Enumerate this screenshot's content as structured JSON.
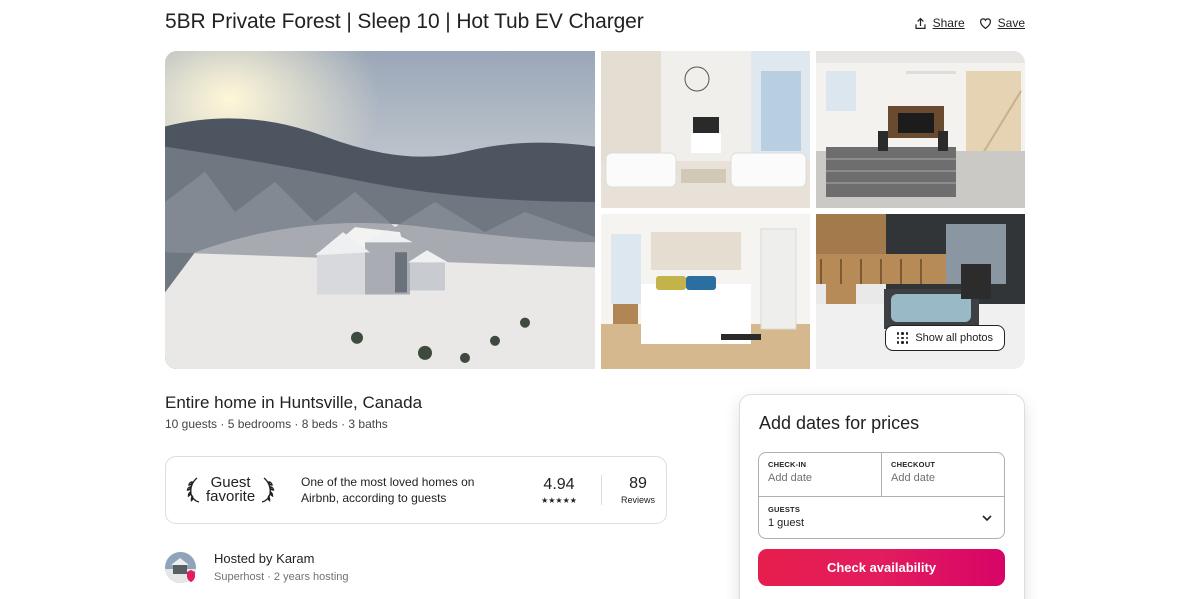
{
  "listing": {
    "title": "5BR Private Forest | Sleep 10 | Hot Tub EV Charger",
    "subtitle": "Entire home in Huntsville, Canada",
    "meta": "10 guests · 5 bedrooms · 8 beds · 3 baths"
  },
  "actions": {
    "share_label": "Share",
    "save_label": "Save",
    "share_icon": "share-icon",
    "save_icon": "heart-icon"
  },
  "gallery": {
    "photos": [
      {
        "name": "snowy-house-aerial-photo"
      },
      {
        "name": "living-room-photo"
      },
      {
        "name": "game-room-photo"
      },
      {
        "name": "bedroom-photo"
      },
      {
        "name": "hot-tub-deck-photo"
      }
    ],
    "show_all_label": "Show all photos",
    "show_all_icon": "grid-dots-icon"
  },
  "guest_favorite": {
    "badge_line1": "Guest",
    "badge_line2": "favorite",
    "description": "One of the most loved homes on Airbnb, according to guests",
    "rating": "4.94",
    "stars": "★★★★★",
    "reviews_count": "89",
    "reviews_label": "Reviews"
  },
  "host": {
    "name": "Hosted by Karam",
    "details": "Superhost · 2 years hosting"
  },
  "booking": {
    "title": "Add dates for prices",
    "checkin_label": "CHECK-IN",
    "checkin_value": "Add date",
    "checkout_label": "CHECKOUT",
    "checkout_value": "Add date",
    "guests_label": "GUESTS",
    "guests_value": "1 guest",
    "button_label": "Check availability"
  },
  "colors": {
    "text": "#222222",
    "muted": "#717171",
    "brand_start": "#e61e4d",
    "brand_end": "#d70466",
    "border": "#dddddd"
  }
}
